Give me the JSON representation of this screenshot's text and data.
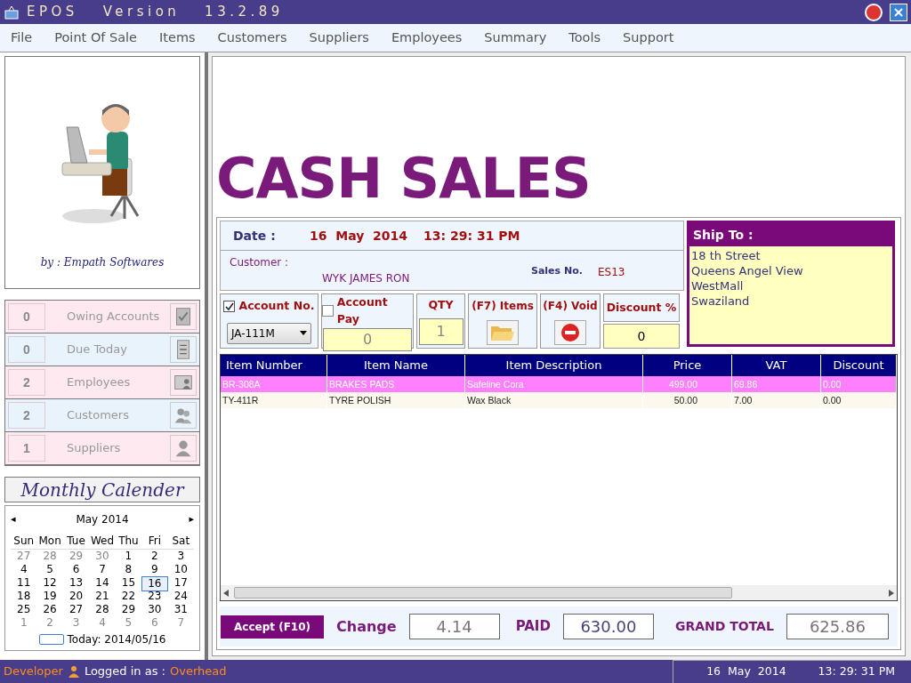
{
  "window": {
    "title": "EPOS   Version   13.2.89"
  },
  "menu": [
    "File",
    "Point Of Sale",
    "Items",
    "Customers",
    "Suppliers",
    "Employees",
    "Summary",
    "Tools",
    "Support"
  ],
  "logo_panel": {
    "credit": "by : Empath Softwares"
  },
  "stats": [
    {
      "count": "0",
      "label": "Owing Accounts",
      "color": "#fde9ef"
    },
    {
      "count": "0",
      "label": "Due Today",
      "color": "#e9f3fc"
    },
    {
      "count": "2",
      "label": "Employees",
      "color": "#fde9ef"
    },
    {
      "count": "2",
      "label": "Customers",
      "color": "#e9f3fc"
    },
    {
      "count": "1",
      "label": "Suppliers",
      "color": "#fde9ef"
    }
  ],
  "calendar": {
    "title": "Monthly Calender",
    "month": "May 2014",
    "prev": "◂",
    "next": "▸",
    "weekdays": [
      "Sun",
      "Mon",
      "Tue",
      "Wed",
      "Thu",
      "Fri",
      "Sat"
    ],
    "weeks": [
      [
        {
          "d": "27",
          "muted": true,
          "selected": false
        },
        {
          "d": "28",
          "muted": true,
          "selected": false
        },
        {
          "d": "29",
          "muted": true,
          "selected": false
        },
        {
          "d": "30",
          "muted": true,
          "selected": false
        },
        {
          "d": "1",
          "muted": false,
          "selected": false
        },
        {
          "d": "2",
          "muted": false,
          "selected": false
        },
        {
          "d": "3",
          "muted": false,
          "selected": false
        }
      ],
      [
        {
          "d": "4",
          "muted": false,
          "selected": false
        },
        {
          "d": "5",
          "muted": false,
          "selected": false
        },
        {
          "d": "6",
          "muted": false,
          "selected": false
        },
        {
          "d": "7",
          "muted": false,
          "selected": false
        },
        {
          "d": "8",
          "muted": false,
          "selected": false
        },
        {
          "d": "9",
          "muted": false,
          "selected": false
        },
        {
          "d": "10",
          "muted": false,
          "selected": false
        }
      ],
      [
        {
          "d": "11",
          "muted": false,
          "selected": false
        },
        {
          "d": "12",
          "muted": false,
          "selected": false
        },
        {
          "d": "13",
          "muted": false,
          "selected": false
        },
        {
          "d": "14",
          "muted": false,
          "selected": false
        },
        {
          "d": "15",
          "muted": false,
          "selected": false
        },
        {
          "d": "16",
          "muted": false,
          "selected": true
        },
        {
          "d": "17",
          "muted": false,
          "selected": false
        }
      ],
      [
        {
          "d": "18",
          "muted": false,
          "selected": false
        },
        {
          "d": "19",
          "muted": false,
          "selected": false
        },
        {
          "d": "20",
          "muted": false,
          "selected": false
        },
        {
          "d": "21",
          "muted": false,
          "selected": false
        },
        {
          "d": "22",
          "muted": false,
          "selected": false
        },
        {
          "d": "23",
          "muted": false,
          "selected": false
        },
        {
          "d": "24",
          "muted": false,
          "selected": false
        }
      ],
      [
        {
          "d": "25",
          "muted": false,
          "selected": false
        },
        {
          "d": "26",
          "muted": false,
          "selected": false
        },
        {
          "d": "27",
          "muted": false,
          "selected": false
        },
        {
          "d": "28",
          "muted": false,
          "selected": false
        },
        {
          "d": "29",
          "muted": false,
          "selected": false
        },
        {
          "d": "30",
          "muted": false,
          "selected": false
        },
        {
          "d": "31",
          "muted": false,
          "selected": false
        }
      ],
      [
        {
          "d": "1",
          "muted": true,
          "selected": false
        },
        {
          "d": "2",
          "muted": true,
          "selected": false
        },
        {
          "d": "3",
          "muted": true,
          "selected": false
        },
        {
          "d": "4",
          "muted": true,
          "selected": false
        },
        {
          "d": "5",
          "muted": true,
          "selected": false
        },
        {
          "d": "6",
          "muted": true,
          "selected": false
        },
        {
          "d": "7",
          "muted": true,
          "selected": false
        }
      ]
    ],
    "today": "Today: 2014/05/16"
  },
  "heading": "CASH SALES",
  "info": {
    "date_label": "Date :",
    "date": "16  May  2014",
    "time": "13: 29: 31 PM",
    "customer_label": "Customer :",
    "customer": "WYK JAMES RON",
    "sales_no_label": "Sales No.",
    "sales_no": "ES13"
  },
  "ship_to": {
    "title": "Ship To :",
    "lines": [
      "18 th Street",
      "Queens Angel View",
      "WestMall",
      "Swaziland"
    ]
  },
  "controls": {
    "account_no": {
      "label": "Account No.",
      "checked": true,
      "value": "JA-111M"
    },
    "account_pay": {
      "label": "Account Pay",
      "checked": false,
      "value": "0"
    },
    "qty": {
      "label": "QTY",
      "value": "1"
    },
    "items": {
      "label": "(F7) Items"
    },
    "void": {
      "label": "(F4) Void"
    },
    "discount": {
      "label": "Discount %",
      "value": "0"
    }
  },
  "table": {
    "columns": [
      "Item Number",
      "Item Name",
      "Item Description",
      "Price",
      "VAT",
      "Discount"
    ],
    "rows": [
      {
        "selected": true,
        "cells": [
          "BR-308A",
          "BRAKES PADS",
          "Safeline Cora",
          "499.00",
          "69.86",
          "0.00"
        ]
      },
      {
        "selected": false,
        "cells": [
          "TY-411R",
          "TYRE POLISH",
          "Wax Black",
          "50.00",
          "7.00",
          "0.00"
        ]
      }
    ]
  },
  "totals": {
    "accept": "Accept (F10)",
    "change_label": "Change",
    "change": "4.14",
    "paid_label": "PAID",
    "paid": "630.00",
    "grand_total_label": "GRAND TOTAL",
    "grand_total": "625.86"
  },
  "status_bar": {
    "role": "Developer",
    "logged_label": "Logged in as :",
    "user": "Overhead",
    "date": "16  May  2014",
    "time": "13: 29: 31 PM"
  }
}
